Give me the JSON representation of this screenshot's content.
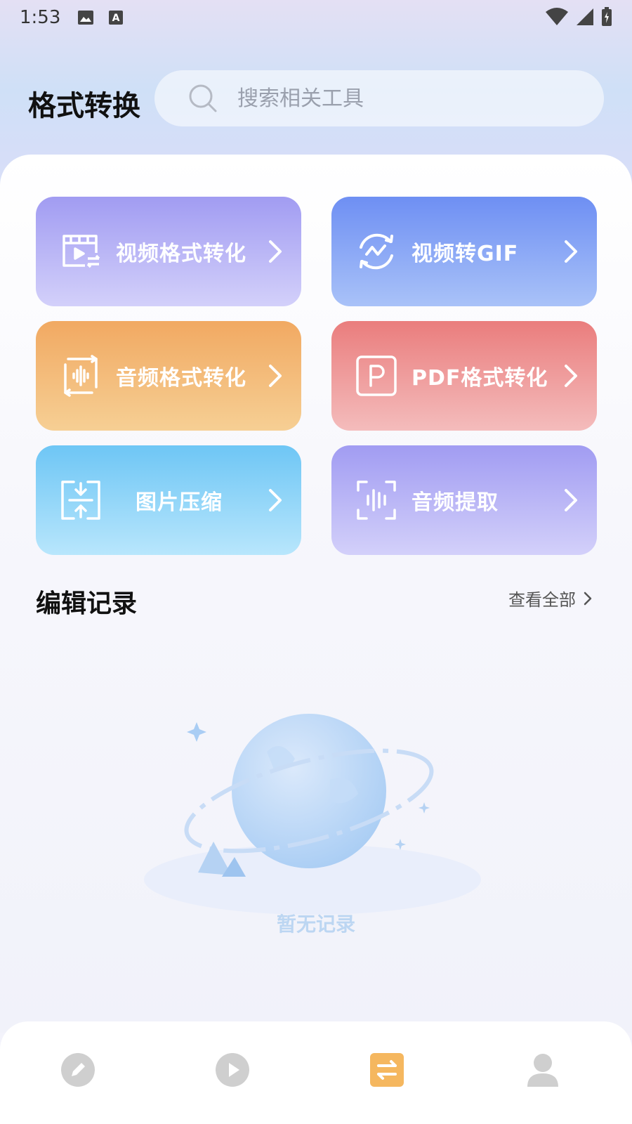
{
  "status_bar": {
    "time": "1:53",
    "icons": [
      "image-icon",
      "text-a-icon",
      "wifi-icon",
      "signal-icon",
      "battery-icon"
    ]
  },
  "header": {
    "title": "格式转换",
    "search": {
      "placeholder": "搜索相关工具",
      "value": ""
    }
  },
  "tools": [
    {
      "label": "视频格式转化",
      "icon": "video-convert-icon",
      "color": "#a19cf2"
    },
    {
      "label": "视频转GIF",
      "icon": "gif-refresh-icon",
      "color": "#6e8ff3"
    },
    {
      "label": "音频格式转化",
      "icon": "audio-convert-icon",
      "color": "#f1a962"
    },
    {
      "label": "PDF格式转化",
      "icon": "pdf-icon",
      "color": "#ea7d7d"
    },
    {
      "label": "图片压缩",
      "icon": "compress-icon",
      "color": "#6ec6f5"
    },
    {
      "label": "音频提取",
      "icon": "audio-extract-icon",
      "color": "#a19cf2"
    }
  ],
  "records": {
    "title": "编辑记录",
    "view_all": "查看全部",
    "empty_text": "暂无记录"
  },
  "tab_bar": {
    "tabs": [
      {
        "icon": "edit-icon",
        "active": false
      },
      {
        "icon": "play-icon",
        "active": false
      },
      {
        "icon": "convert-icon",
        "active": true
      },
      {
        "icon": "profile-icon",
        "active": false
      }
    ],
    "active_color": "#f5b75f"
  }
}
